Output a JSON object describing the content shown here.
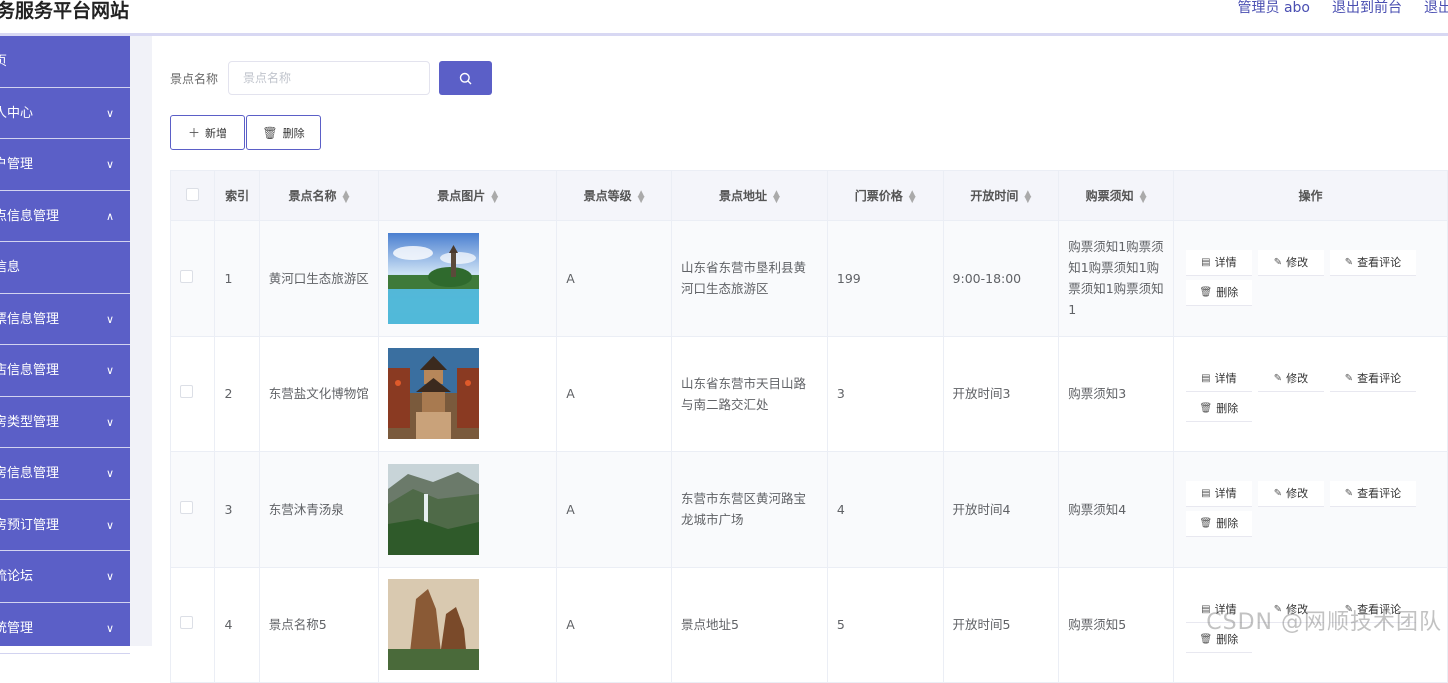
{
  "header": {
    "title": "务服务平台网站",
    "links": [
      "管理员 abo",
      "退出到前台",
      "退出"
    ]
  },
  "sidebar": {
    "items": [
      {
        "label": "页",
        "chevron": ""
      },
      {
        "label": "人中心",
        "chevron": "∨"
      },
      {
        "label": "户管理",
        "chevron": "∨"
      },
      {
        "label": "点信息管理",
        "chevron": "∧"
      },
      {
        "label": "信息",
        "chevron": ""
      },
      {
        "label": "票信息管理",
        "chevron": "∨"
      },
      {
        "label": "店信息管理",
        "chevron": "∨"
      },
      {
        "label": "房类型管理",
        "chevron": "∨"
      },
      {
        "label": "房信息管理",
        "chevron": "∨"
      },
      {
        "label": "房预订管理",
        "chevron": "∨"
      },
      {
        "label": "流论坛",
        "chevron": "∨"
      },
      {
        "label": "统管理",
        "chevron": "∨"
      }
    ]
  },
  "search": {
    "label": "景点名称",
    "placeholder": "景点名称",
    "value": ""
  },
  "toolbar": {
    "add_label": "新增",
    "delete_label": "删除"
  },
  "table": {
    "columns": [
      "索引",
      "景点名称",
      "景点图片",
      "景点等级",
      "景点地址",
      "门票价格",
      "开放时间",
      "购票须知",
      "操作"
    ],
    "rows": [
      {
        "index": "1",
        "name": "黄河口生态旅游区",
        "level": "A",
        "address": "山东省东营市垦利县黄河口生态旅游区",
        "price": "199",
        "hours": "9:00-18:00",
        "notice": "购票须知1购票须知1购票须知1购票须知1购票须知1"
      },
      {
        "index": "2",
        "name": "东营盐文化博物馆",
        "level": "A",
        "address": "山东省东营市天目山路与南二路交汇处",
        "price": "3",
        "hours": "开放时间3",
        "notice": "购票须知3"
      },
      {
        "index": "3",
        "name": "东营沐青汤泉",
        "level": "A",
        "address": "东营市东营区黄河路宝龙城市广场",
        "price": "4",
        "hours": "开放时间4",
        "notice": "购票须知4"
      },
      {
        "index": "4",
        "name": "景点名称5",
        "level": "A",
        "address": "景点地址5",
        "price": "5",
        "hours": "开放时间5",
        "notice": "购票须知5"
      }
    ],
    "actions": {
      "detail": "详情",
      "edit": "修改",
      "comments": "查看评论",
      "delete": "删除"
    }
  },
  "watermark": "CSDN @网顺技术团队",
  "colors": {
    "accent": "#5b5fc7",
    "sidebar": "#5b5fc7"
  }
}
